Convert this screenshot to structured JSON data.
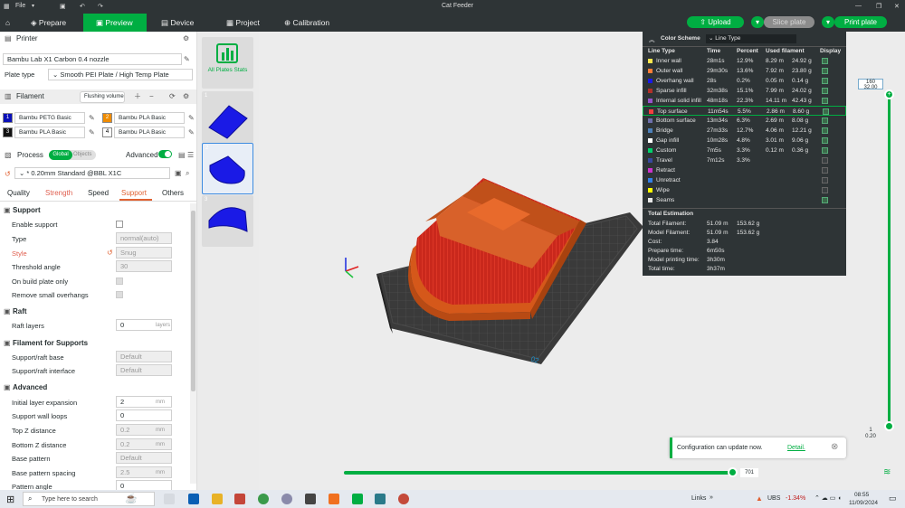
{
  "window": {
    "title": "Cat Feeder",
    "file_menu": "File"
  },
  "nav": {
    "prepare": "Prepare",
    "preview": "Preview",
    "device": "Device",
    "project": "Project",
    "calibration": "Calibration",
    "upload": "Upload",
    "slice": "Slice plate",
    "print": "Print plate"
  },
  "printer": {
    "section": "Printer",
    "name": "Bambu Lab X1 Carbon 0.4 nozzle",
    "plate_label": "Plate type",
    "plate_value": "Smooth PEI Plate / High Temp Plate"
  },
  "filament": {
    "section": "Filament",
    "flushing": "Flushing volumes",
    "slots": [
      {
        "num": "1",
        "name": "Bambu PETG Basic",
        "color": "#0a10b8"
      },
      {
        "num": "2",
        "name": "Bambu PLA Basic",
        "color": "#f08c00"
      },
      {
        "num": "3",
        "name": "Bambu PLA Basic",
        "color": "#111111"
      },
      {
        "num": "4",
        "name": "Bambu PLA Basic",
        "color": "#ffffff"
      }
    ]
  },
  "process": {
    "section": "Process",
    "global": "Global",
    "objects": "Objects",
    "advanced": "Advanced",
    "preset": "* 0.20mm Standard @BBL X1C",
    "tabs": [
      "Quality",
      "Strength",
      "Speed",
      "Support",
      "Others"
    ]
  },
  "settings": {
    "support_h": "Support",
    "enable_support": "Enable support",
    "type": "Type",
    "type_val": "normal(auto)",
    "style": "Style",
    "style_val": "Snug",
    "threshold": "Threshold angle",
    "threshold_val": "30",
    "on_build": "On build plate only",
    "remove_small": "Remove small overhangs",
    "raft_h": "Raft",
    "raft_layers": "Raft layers",
    "raft_val": "0",
    "raft_unit": "layers",
    "ffs_h": "Filament for Supports",
    "base": "Support/raft base",
    "base_val": "Default",
    "interface": "Support/raft interface",
    "interface_val": "Default",
    "adv_h": "Advanced",
    "init_exp": "Initial layer expansion",
    "init_exp_val": "2",
    "mm": "mm",
    "wall_loops": "Support wall loops",
    "wall_loops_val": "0",
    "topz": "Top Z distance",
    "topz_val": "0.2",
    "botz": "Bottom Z distance",
    "botz_val": "0.2",
    "base_pattern": "Base pattern",
    "base_pattern_val": "Default",
    "spacing": "Base pattern spacing",
    "spacing_val": "2.5",
    "pattern_angle": "Pattern angle",
    "pattern_angle_val": "0"
  },
  "plates": {
    "all_label": "All Plates Stats",
    "nums": [
      "1",
      "2",
      "3"
    ]
  },
  "legend": {
    "scheme": "Color Scheme",
    "scheme_val": "Line Type",
    "headers": [
      "Line Type",
      "Time",
      "Percent",
      "Used filament",
      "Display"
    ],
    "rows": [
      {
        "name": "Inner wall",
        "time": "28m1s",
        "pct": "12.9%",
        "m": "8.29 m",
        "g": "24.92 g",
        "color": "#ffe64d",
        "chk": true
      },
      {
        "name": "Outer wall",
        "time": "29m30s",
        "pct": "13.6%",
        "m": "7.92 m",
        "g": "23.80 g",
        "color": "#ff7d38",
        "chk": true
      },
      {
        "name": "Overhang wall",
        "time": "28s",
        "pct": "0.2%",
        "m": "0.05 m",
        "g": "0.14 g",
        "color": "#1a19e6",
        "chk": true
      },
      {
        "name": "Sparse infill",
        "time": "32m38s",
        "pct": "15.1%",
        "m": "7.99 m",
        "g": "24.02 g",
        "color": "#b03029",
        "chk": true
      },
      {
        "name": "Internal solid infill",
        "time": "48m18s",
        "pct": "22.3%",
        "m": "14.11 m",
        "g": "42.43 g",
        "color": "#9654cc",
        "chk": true
      },
      {
        "name": "Top surface",
        "time": "11m54s",
        "pct": "5.5%",
        "m": "2.86 m",
        "g": "8.60 g",
        "color": "#f04040",
        "chk": true
      },
      {
        "name": "Bottom surface",
        "time": "13m34s",
        "pct": "6.3%",
        "m": "2.69 m",
        "g": "8.08 g",
        "color": "#6d6fab",
        "chk": true
      },
      {
        "name": "Bridge",
        "time": "27m33s",
        "pct": "12.7%",
        "m": "4.06 m",
        "g": "12.21 g",
        "color": "#4d80ba",
        "chk": true
      },
      {
        "name": "Gap infill",
        "time": "10m28s",
        "pct": "4.8%",
        "m": "3.01 m",
        "g": "9.06 g",
        "color": "#ffffff",
        "chk": true
      },
      {
        "name": "Custom",
        "time": "7m5s",
        "pct": "3.3%",
        "m": "0.12 m",
        "g": "0.36 g",
        "color": "#00d16b",
        "chk": true
      },
      {
        "name": "Travel",
        "time": "7m12s",
        "pct": "3.3%",
        "m": "",
        "g": "",
        "color": "#38489e",
        "chk": false
      },
      {
        "name": "Retract",
        "time": "",
        "pct": "",
        "m": "",
        "g": "",
        "color": "#cc33cc",
        "chk": false
      },
      {
        "name": "Unretract",
        "time": "",
        "pct": "",
        "m": "",
        "g": "",
        "color": "#3380e6",
        "chk": false
      },
      {
        "name": "Wipe",
        "time": "",
        "pct": "",
        "m": "",
        "g": "",
        "color": "#ffff00",
        "chk": false
      },
      {
        "name": "Seams",
        "time": "",
        "pct": "",
        "m": "",
        "g": "",
        "color": "#e6e6e6",
        "chk": true
      }
    ],
    "total_h": "Total Estimation",
    "totals": [
      {
        "k": "Total Filament:",
        "a": "51.09 m",
        "b": "153.62 g"
      },
      {
        "k": "Model Filament:",
        "a": "51.09 m",
        "b": "153.62 g"
      },
      {
        "k": "Cost:",
        "a": "3.84",
        "b": ""
      },
      {
        "k": "Prepare time:",
        "a": "6m50s",
        "b": ""
      },
      {
        "k": "Model printing time:",
        "a": "3h30m",
        "b": ""
      },
      {
        "k": "Total time:",
        "a": "3h37m",
        "b": ""
      }
    ]
  },
  "slider": {
    "top": "160",
    "top2": "32.00",
    "bottom": "1",
    "bottom2": "0.20",
    "h_val": "701"
  },
  "notice": {
    "text": "Configuration can update now.",
    "link": "Detail."
  },
  "plate_mark": "02",
  "taskbar": {
    "search": "Type here to search",
    "links": "Links",
    "stock": "UBS",
    "stock_chg": "-1.34%",
    "time": "08:55",
    "date": "11/09/2024"
  }
}
